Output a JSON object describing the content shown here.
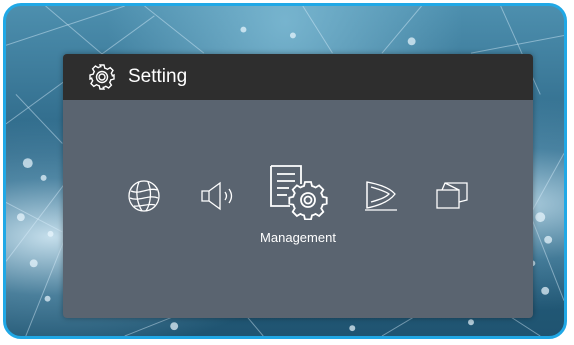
{
  "panel": {
    "title": "Setting",
    "title_icon": "gear-icon",
    "selected_label": "Management"
  },
  "menu": {
    "items": [
      {
        "icon": "globe-icon",
        "selected": false
      },
      {
        "icon": "speaker-icon",
        "selected": false
      },
      {
        "icon": "management-icon",
        "selected": true
      },
      {
        "icon": "display-icon",
        "selected": false
      },
      {
        "icon": "screen-adjust-icon",
        "selected": false
      }
    ]
  },
  "colors": {
    "frame_border": "#20a8e6",
    "panel_bg": "#5a6470",
    "header_bg": "#2e2e2e",
    "text": "#ffffff"
  }
}
